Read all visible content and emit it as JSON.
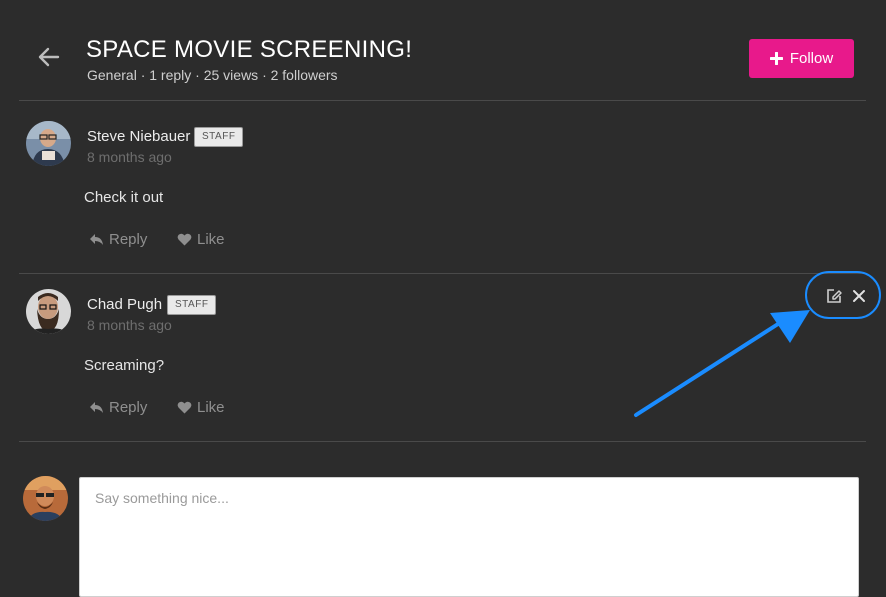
{
  "topic": {
    "title": "SPACE MOVIE SCREENING!",
    "meta": "General · 1 reply · 25 views · 2 followers",
    "follow_label": "Follow"
  },
  "posts": [
    {
      "author": "Steve Niebauer",
      "badge": "STAFF",
      "time": "8 months ago",
      "body": "Check it out",
      "reply_label": "Reply",
      "like_label": "Like"
    },
    {
      "author": "Chad Pugh",
      "badge": "STAFF",
      "time": "8 months ago",
      "body": "Screaming?",
      "reply_label": "Reply",
      "like_label": "Like"
    }
  ],
  "composer": {
    "placeholder": "Say something nice..."
  },
  "colors": {
    "background": "#2c2c2c",
    "accent": "#e8198b",
    "annotation": "#1a8cff"
  },
  "icons": {
    "back": "arrow-left-icon",
    "follow": "plus-icon",
    "reply": "reply-icon",
    "like": "heart-icon",
    "edit": "edit-icon",
    "delete": "close-icon"
  }
}
